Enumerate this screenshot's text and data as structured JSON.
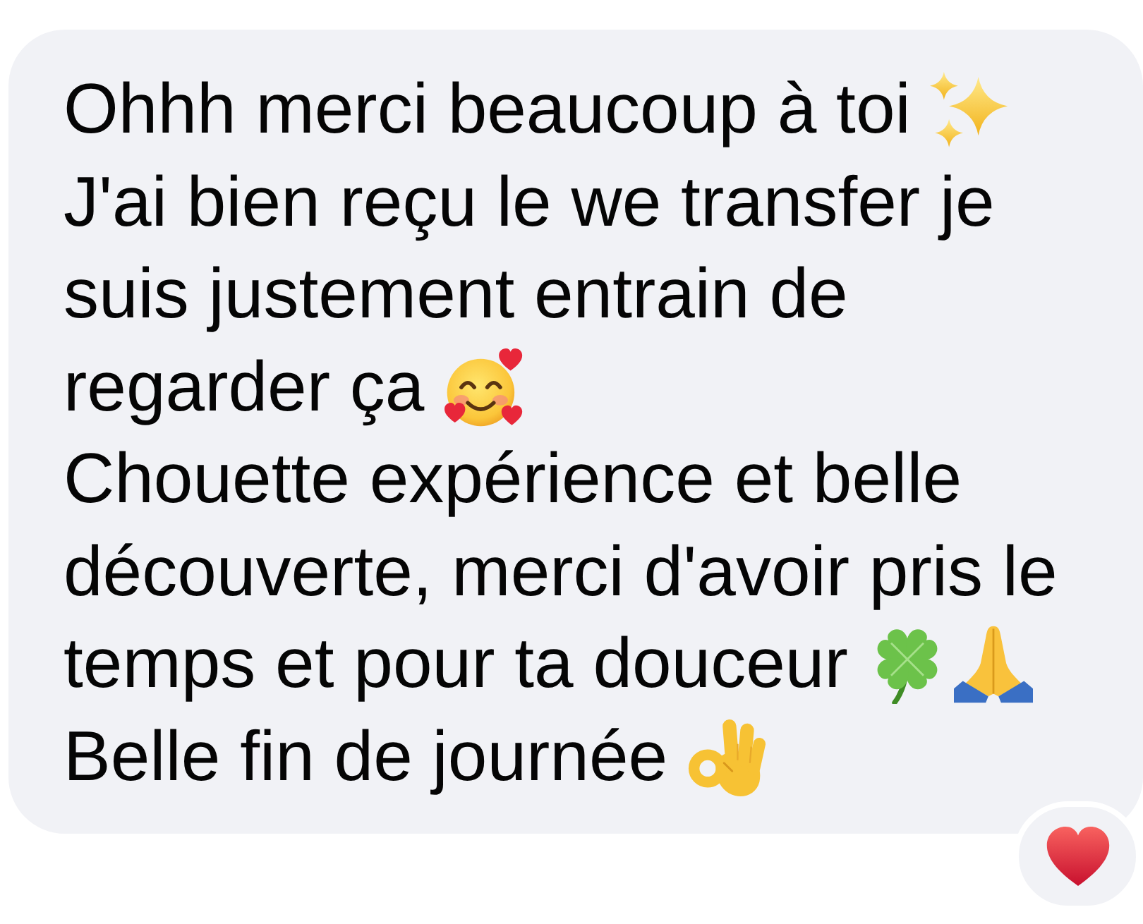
{
  "message": {
    "lines": [
      {
        "text": "Ohhh merci beaucoup à toi",
        "emojis": [
          {
            "kind": "sparkles"
          }
        ]
      },
      {
        "text": "J'ai bien reçu le we transfer je"
      },
      {
        "text": "suis justement entrain de"
      },
      {
        "text": "regarder ça",
        "emojis": [
          {
            "kind": "smiling_face_with_hearts"
          }
        ]
      },
      {
        "text": "Chouette expérience et belle"
      },
      {
        "text": "découverte, merci d'avoir pris le"
      },
      {
        "text": "temps et pour ta douceur",
        "emojis": [
          {
            "kind": "clover"
          },
          {
            "kind": "folded_hands"
          }
        ]
      },
      {
        "text": "Belle fin de journée",
        "emojis": [
          {
            "kind": "ok_hand"
          }
        ]
      }
    ],
    "reactions": [
      {
        "kind": "heart"
      }
    ]
  }
}
